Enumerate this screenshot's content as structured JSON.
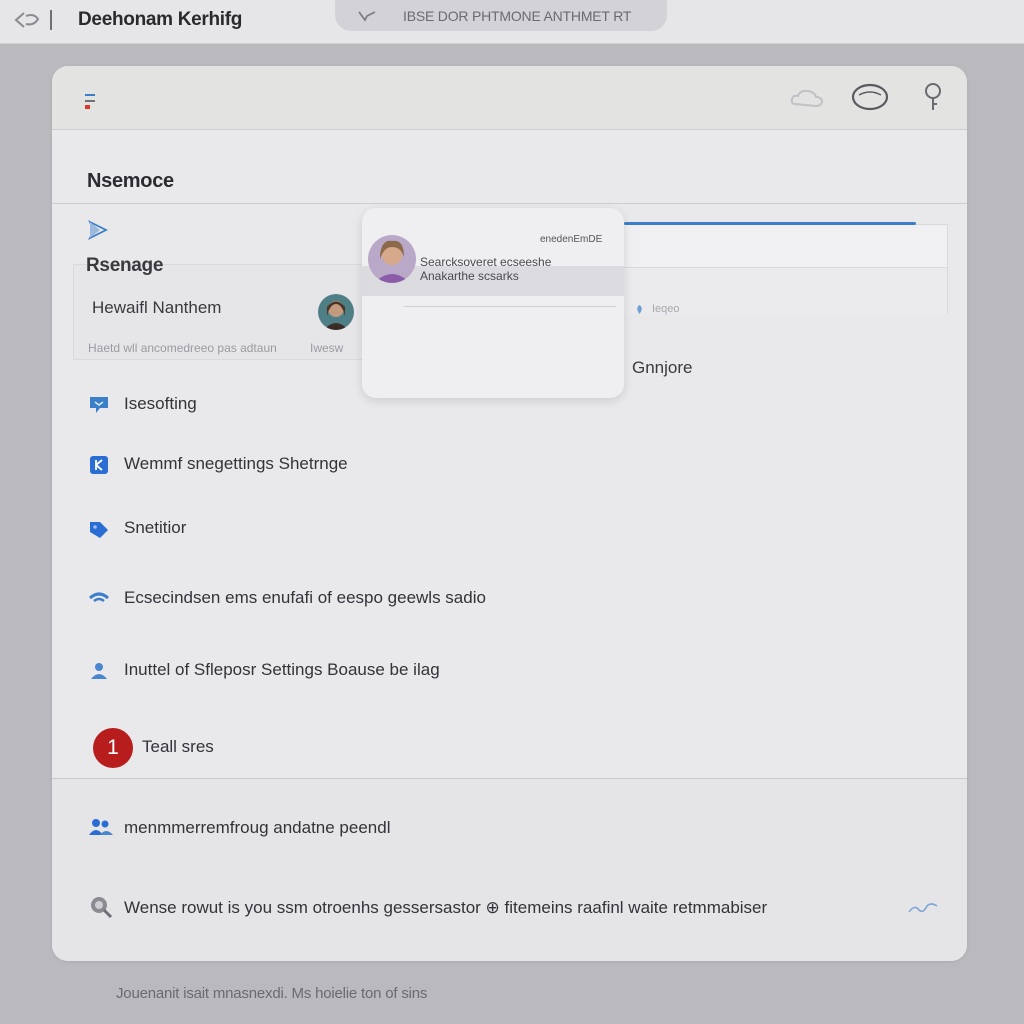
{
  "topbar": {
    "title": "Deehonam Kerhifg",
    "search_text": "IBSE DOR PHTMONE ANTHMET RT"
  },
  "card": {
    "section_title": "Nsemoce",
    "panel": {
      "title": "Rsenage",
      "name": "Hewaifl Nanthem",
      "note": "Haetd wll ancomedreeo pas adtaun",
      "note2": "Iwesw"
    },
    "popover": {
      "top_text": "enedenEmDE",
      "line1": "Searcksoveret ecseeshe",
      "line2": "Anakarthe scsarks"
    },
    "strip_hint": "Ieqeo",
    "compose_label": "Gnnjore",
    "items": [
      {
        "label": "Isesofting",
        "icon": "chat-bubble-icon"
      },
      {
        "label": "Wemmf snegettings Shetrnge",
        "icon": "checkbox-icon"
      },
      {
        "label": "Snetitior",
        "icon": "tag-icon"
      },
      {
        "label": "Ecsecindsen ems enufafi of eespo geewls sadio",
        "icon": "wifi-icon"
      },
      {
        "label": "Inuttel of Sfleposr Settings Boause be ilag",
        "icon": "users-icon"
      },
      {
        "label": "Teall sres",
        "icon": "notification-badge"
      },
      {
        "label": "menmmerremfroug andatne peendl",
        "icon": "people-icon"
      },
      {
        "label": "Wense rowut is you ssm otroenhs gessersastor ⊕ fitemeins raafinl waite retmmabiser",
        "icon": "search-bug-icon"
      }
    ],
    "badge_count": "1"
  },
  "footnote": "Jouenanit isait mnasnexdi. Ms hoielie ton of sins",
  "colors": {
    "accent_blue": "#3c7fc9",
    "badge_red": "#b81d1d",
    "menu_icon_red": "#d93a2f"
  }
}
